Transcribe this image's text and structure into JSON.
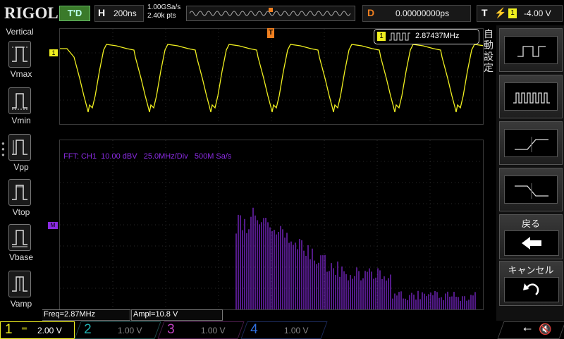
{
  "top": {
    "logo": "RIGOL",
    "run_status": "T'D",
    "horizontal_letter": "H",
    "timebase": "200ns",
    "sample_rate": "1.00GSa/s",
    "memory_depth": "2.40k pts",
    "delay_letter": "D",
    "delay": "0.00000000ps",
    "trigger_letter": "T",
    "trigger_level": "-4.00 V"
  },
  "left_menu": {
    "title": "Vertical",
    "items": [
      {
        "label": "Vmax",
        "icon": "vmax-icon"
      },
      {
        "label": "Vmin",
        "icon": "vmin-icon"
      },
      {
        "label": "Vpp",
        "icon": "vpp-icon"
      },
      {
        "label": "Vtop",
        "icon": "vtop-icon"
      },
      {
        "label": "Vbase",
        "icon": "vbase-icon"
      },
      {
        "label": "Vamp",
        "icon": "vamp-icon"
      }
    ]
  },
  "waveform": {
    "channel_marker": "1",
    "freq_badge_channel": "1",
    "freq_badge_value": "2.87437MHz",
    "color": "#f0f020"
  },
  "fft": {
    "info": "FFT: CH1  10.00 dBV   25.0MHz/Div   500M Sa/s",
    "marker": "M",
    "color": "#8a2be2"
  },
  "measurements": {
    "freq": "Freq=2.87MHz",
    "ampl": "Ampl=10.8 V"
  },
  "right_menu": {
    "auto_label": "自\n動\n設\n定",
    "buttons": [
      {
        "name": "square-wave-icon"
      },
      {
        "name": "pulse-train-icon"
      },
      {
        "name": "rising-edge-icon"
      },
      {
        "name": "falling-edge-icon"
      }
    ],
    "back_label": "戻る",
    "cancel_label": "キャンセル"
  },
  "channels": [
    {
      "num": "1",
      "value": "2.00 V",
      "color": "#f0f020",
      "active": true
    },
    {
      "num": "2",
      "value": "1.00 V",
      "color": "#20b0b0",
      "active": false
    },
    {
      "num": "3",
      "value": "1.00 V",
      "color": "#c040c0",
      "active": false
    },
    {
      "num": "4",
      "value": "1.00 V",
      "color": "#3070e0",
      "active": false
    }
  ]
}
